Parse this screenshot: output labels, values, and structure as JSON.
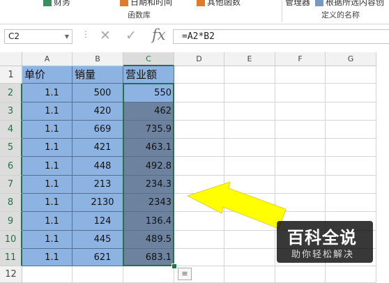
{
  "ribbon": {
    "item_finance": "财务",
    "item_datetime": "日期和时间",
    "item_other_functions": "其他函数",
    "item_name_manager": "管理器",
    "item_create_from_selection": "根据所选内容创",
    "group_function_library": "函数库",
    "group_defined_names": "定义的名称"
  },
  "formula_bar": {
    "name_box": "C2",
    "formula": "=A2*B2",
    "cancel_icon": "close-icon",
    "enter_icon": "check-icon",
    "fx_label": "fx"
  },
  "columns": [
    "A",
    "B",
    "C",
    "D",
    "E",
    "F",
    "G"
  ],
  "rows": [
    "1",
    "2",
    "3",
    "4",
    "5",
    "6",
    "7",
    "8",
    "9",
    "10",
    "11",
    "12"
  ],
  "table": {
    "headers": [
      "单价",
      "销量",
      "营业额"
    ],
    "data": [
      [
        "1.1",
        "500",
        "550"
      ],
      [
        "1.1",
        "420",
        "462"
      ],
      [
        "1.1",
        "669",
        "735.9"
      ],
      [
        "1.1",
        "421",
        "463.1"
      ],
      [
        "1.1",
        "448",
        "492.8"
      ],
      [
        "1.1",
        "213",
        "234.3"
      ],
      [
        "1.1",
        "2130",
        "2343"
      ],
      [
        "1.1",
        "124",
        "136.4"
      ],
      [
        "1.1",
        "445",
        "489.5"
      ],
      [
        "1.1",
        "621",
        "683.1"
      ]
    ]
  },
  "watermark": {
    "title": "百科全说",
    "subtitle": "助你轻松解决"
  },
  "colors": {
    "table_fill": "#8db3e2",
    "selected_fill": "#6d829f",
    "selection_border": "#217346",
    "arrow": "#ffff00"
  }
}
